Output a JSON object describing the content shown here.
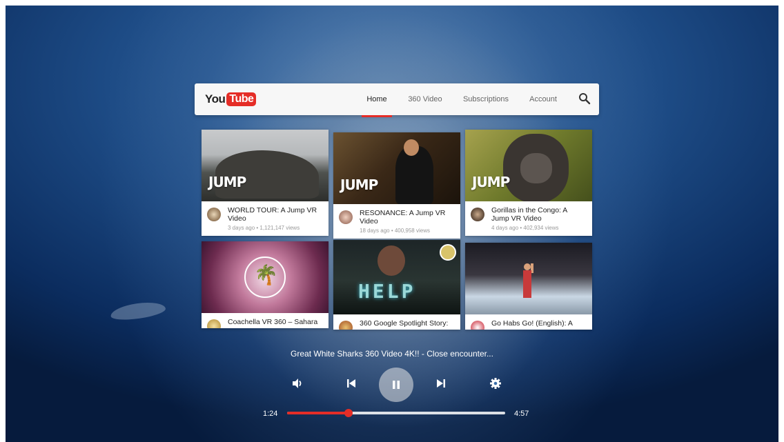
{
  "app": {
    "logo_you": "You",
    "logo_tube": "Tube",
    "accent_color": "#e52d27"
  },
  "nav": {
    "tabs": [
      {
        "label": "Home",
        "active": true
      },
      {
        "label": "360 Video",
        "active": false
      },
      {
        "label": "Subscriptions",
        "active": false
      },
      {
        "label": "Account",
        "active": false
      }
    ],
    "search_icon": "search-icon"
  },
  "videos": [
    {
      "title": "WORLD TOUR: A Jump VR Video",
      "meta": "3 days ago • 1,121,147 views",
      "overlay": "JUMP"
    },
    {
      "title": "RESONANCE: A Jump VR Video",
      "meta": "18 days ago • 400,958 views",
      "overlay": "JUMP"
    },
    {
      "title": "Gorillas in the Congo: A Jump VR Video",
      "meta": "4 days ago • 402,934 views",
      "overlay": "JUMP"
    },
    {
      "title": "Coachella VR 360 – Sahara",
      "meta": ""
    },
    {
      "title": "360 Google Spotlight Story:",
      "meta": "",
      "overlay": "HELP"
    },
    {
      "title": "Go Habs Go! (English): A",
      "meta": ""
    }
  ],
  "player": {
    "now_playing": "Great White Sharks 360 Video 4K!! - Close encounter...",
    "current_time": "1:24",
    "total_time": "4:57",
    "progress_fraction": 0.283
  }
}
